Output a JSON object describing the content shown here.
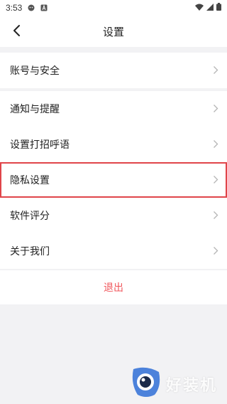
{
  "status_bar": {
    "time": "3:53",
    "icons": [
      "cat-icon",
      "a-square-icon",
      "wifi-icon",
      "signal-icon",
      "battery-icon"
    ]
  },
  "nav": {
    "title": "设置",
    "back_icon": "chevron-left-icon"
  },
  "settings": {
    "account_group": [
      {
        "label": "账号与安全"
      }
    ],
    "main_group": [
      {
        "label": "通知与提醒"
      },
      {
        "label": "设置打招呼语"
      },
      {
        "label": "隐私设置",
        "highlighted": true
      },
      {
        "label": "软件评分"
      },
      {
        "label": "关于我们"
      }
    ],
    "logout_label": "退出"
  },
  "watermark": {
    "text": "好装机"
  },
  "colors": {
    "background": "#f2f2f4",
    "logout_red": "#f0575c",
    "highlight_border": "#e0454a"
  }
}
